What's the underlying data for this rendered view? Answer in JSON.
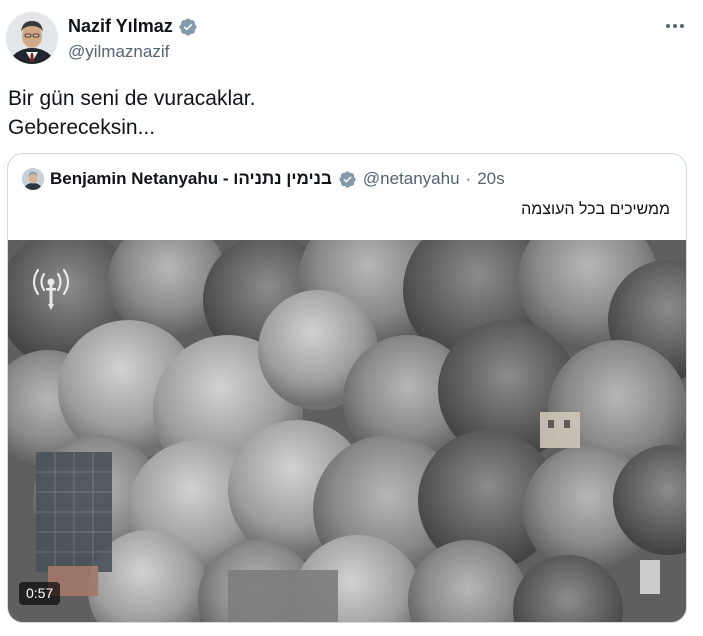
{
  "tweet": {
    "author": {
      "name": "Nazif Yılmaz",
      "handle": "@yilmaznazif",
      "verified": true
    },
    "text_lines": [
      "Bir gün seni de vuracaklar.",
      "Gebereceksin..."
    ],
    "more_icon": "more-horizontal-icon"
  },
  "quote": {
    "author_name": "Benjamin Netanyahu - בנימין נתניהו",
    "handle": "@netanyahu",
    "separator": "·",
    "time": "20s",
    "verified": true,
    "text": "ממשיכים בכל העוצמה",
    "media": {
      "type": "video",
      "duration": "0:57",
      "overlay_icon": "idf-logo-icon",
      "description_icon": "smoke-explosion-video"
    }
  },
  "colors": {
    "verified_blue": "#1d9bf0",
    "text_primary": "#0f1419",
    "text_secondary": "#536471",
    "border": "#cfd9de"
  }
}
